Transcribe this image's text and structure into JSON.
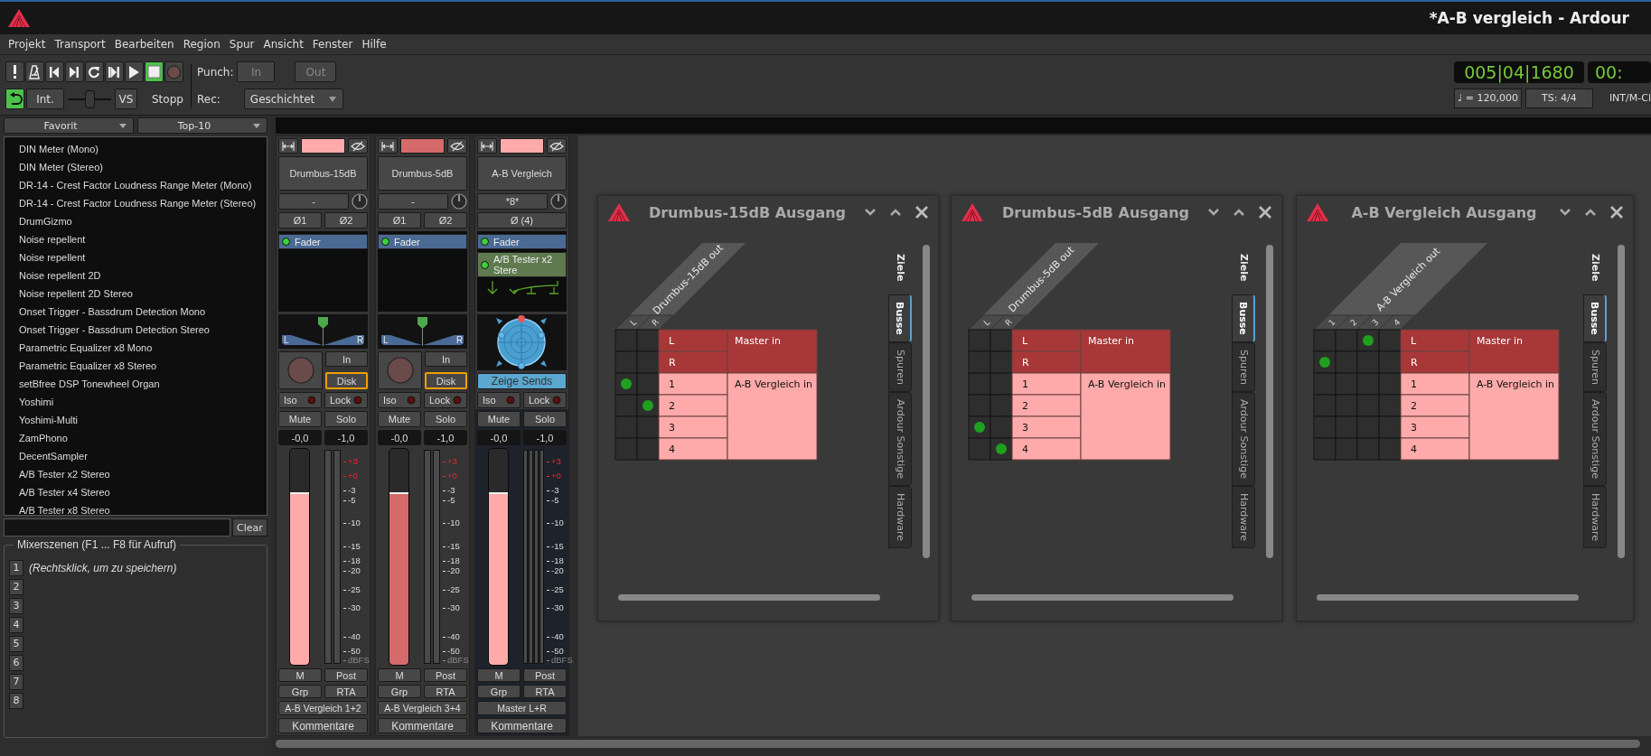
{
  "window": {
    "title": "*A-B vergleich - Ardour"
  },
  "menu": [
    "Projekt",
    "Transport",
    "Bearbeiten",
    "Region",
    "Spur",
    "Ansicht",
    "Fenster",
    "Hilfe"
  ],
  "toolbar": {
    "transport": [
      {
        "kind": "panic",
        "active": false
      },
      {
        "kind": "metronome",
        "active": false
      },
      {
        "kind": "start",
        "active": false
      },
      {
        "kind": "end",
        "active": false
      },
      {
        "kind": "loop",
        "active": false
      },
      {
        "kind": "range",
        "active": false
      },
      {
        "kind": "play",
        "active": false
      },
      {
        "kind": "stop",
        "active": true
      },
      {
        "kind": "record",
        "active": false
      }
    ],
    "auto_return": {
      "active": true
    },
    "sync_button": "Int.",
    "shuttle": {
      "level": 0.5
    },
    "vari_speed": "VS",
    "status": "Stopp",
    "punch_label": "Punch:",
    "punch": [
      {
        "label": "In",
        "disabled": true
      },
      {
        "label": "Out",
        "disabled": true
      }
    ],
    "rec_label": "Rec:",
    "rec_mode": "Geschichtet",
    "clock": "005|04|1680",
    "clock_2": "00:",
    "tempo": "♩ = 120,000",
    "meter": "TS: 4/4",
    "sync_source": "INT/M-Cl"
  },
  "sidebar": {
    "filters": [
      "Favorit",
      "Top-10"
    ],
    "plugins": [
      "DIN Meter (Mono)",
      "DIN Meter (Stereo)",
      "DR-14 - Crest Factor Loudness Range Meter (Mono)",
      "DR-14 - Crest Factor Loudness Range Meter (Stereo)",
      "DrumGizmo",
      "Noise repellent",
      "Noise repellent",
      "Noise repellent 2D",
      "Noise repellent 2D Stereo",
      "Onset Trigger - Bassdrum Detection Mono",
      "Onset Trigger - Bassdrum Detection Stereo",
      "Parametric Equalizer x8 Mono",
      "Parametric Equalizer x8 Stereo",
      "setBfree DSP Tonewheel Organ",
      "Yoshimi",
      "Yoshimi-Multi",
      "ZamPhono",
      "DecentSampler",
      "A/B Tester x2 Stereo",
      "A/B Tester x4 Stereo",
      "A/B Tester x8 Stereo"
    ],
    "clear_button": "Clear",
    "scenes": {
      "title": "Mixerszenen (F1 ... F8 für Aufruf)",
      "slots": [
        {
          "key": "1",
          "label": "(Rechtsklick, um zu speichern)"
        },
        {
          "key": "2"
        },
        {
          "key": "3"
        },
        {
          "key": "4"
        },
        {
          "key": "5"
        },
        {
          "key": "6"
        },
        {
          "key": "7"
        },
        {
          "key": "8"
        }
      ]
    }
  },
  "strips": [
    {
      "kind": "track",
      "color": "#ffaaaa",
      "name": "Drumbus-15dB",
      "input": "-",
      "phase": [
        "Ø1",
        "Ø2"
      ],
      "processors": [
        {
          "kind": "fader",
          "name": "Fader",
          "active": true
        }
      ],
      "panner": {
        "kind": "stereo",
        "left": "L",
        "right": "R"
      },
      "rec_armed": false,
      "monitor": [
        {
          "label": "In",
          "active": false
        },
        {
          "label": "Disk",
          "active": true
        }
      ],
      "iso": "Iso",
      "lock": "Lock",
      "mute": "Mute",
      "solo": "Solo",
      "gain": "-0,0",
      "peak": "-1,0",
      "fader": {
        "level": 0.79
      },
      "meter_scale": [
        {
          "label": "+3",
          "color": "#ff2020"
        },
        {
          "label": "+0",
          "color": "#ff2020"
        },
        {
          "label": "-3",
          "color": "#dddddd"
        },
        {
          "label": "-5",
          "color": "#dddddd"
        },
        {
          "label": "-10",
          "color": "#dddddd"
        },
        {
          "label": "-15",
          "color": "#dddddd"
        },
        {
          "label": "-18",
          "color": "#dddddd"
        },
        {
          "label": "-20",
          "color": "#dddddd"
        },
        {
          "label": "-25",
          "color": "#dddddd"
        },
        {
          "label": "-30",
          "color": "#dddddd"
        },
        {
          "label": "-40",
          "color": "#dddddd"
        },
        {
          "label": "-50",
          "color": "#dddddd"
        },
        {
          "label": "dBFS",
          "color": "#888888"
        }
      ],
      "meter_button": "M",
      "meter_point": "Post",
      "group": "Grp",
      "rta": "RTA",
      "output": "A-B Vergleich 1+2",
      "comments": "Kommentare"
    },
    {
      "kind": "track",
      "color": "#d46a6a",
      "name": "Drumbus-5dB",
      "input": "-",
      "phase": [
        "Ø1",
        "Ø2"
      ],
      "processors": [
        {
          "kind": "fader",
          "name": "Fader",
          "active": true
        }
      ],
      "panner": {
        "kind": "stereo",
        "left": "L",
        "right": "R"
      },
      "rec_armed": false,
      "monitor": [
        {
          "label": "In",
          "active": false
        },
        {
          "label": "Disk",
          "active": true
        }
      ],
      "iso": "Iso",
      "lock": "Lock",
      "mute": "Mute",
      "solo": "Solo",
      "gain": "-0,0",
      "peak": "-1,0",
      "fader": {
        "level": 0.79
      },
      "meter_scale": [
        {
          "label": "+3",
          "color": "#ff2020"
        },
        {
          "label": "+0",
          "color": "#ff2020"
        },
        {
          "label": "-3",
          "color": "#dddddd"
        },
        {
          "label": "-5",
          "color": "#dddddd"
        },
        {
          "label": "-10",
          "color": "#dddddd"
        },
        {
          "label": "-15",
          "color": "#dddddd"
        },
        {
          "label": "-18",
          "color": "#dddddd"
        },
        {
          "label": "-20",
          "color": "#dddddd"
        },
        {
          "label": "-25",
          "color": "#dddddd"
        },
        {
          "label": "-30",
          "color": "#dddddd"
        },
        {
          "label": "-40",
          "color": "#dddddd"
        },
        {
          "label": "-50",
          "color": "#dddddd"
        },
        {
          "label": "dBFS",
          "color": "#888888"
        }
      ],
      "meter_button": "M",
      "meter_point": "Post",
      "group": "Grp",
      "rta": "RTA",
      "output": "A-B Vergleich 3+4",
      "comments": "Kommentare"
    },
    {
      "kind": "bus",
      "color": "#ffaaaa",
      "name": "A-B Vergleich",
      "input": "*8*",
      "phase": [
        "Ø (4)"
      ],
      "processors": [
        {
          "kind": "fader",
          "name": "Fader",
          "active": true
        },
        {
          "kind": "plugin",
          "name": "A/B Tester x2 Stere",
          "active": true
        }
      ],
      "panner": {
        "kind": "surround"
      },
      "sends_button": "Zeige Sends",
      "iso": "Iso",
      "lock": "Lock",
      "mute": "Mute",
      "solo": "Solo",
      "gain": "-0,0",
      "peak": "-1,0",
      "fader": {
        "level": 0.79
      },
      "meter_scale": [
        {
          "label": "+3",
          "color": "#ff2020"
        },
        {
          "label": "+0",
          "color": "#ff2020"
        },
        {
          "label": "-3",
          "color": "#dddddd"
        },
        {
          "label": "-5",
          "color": "#dddddd"
        },
        {
          "label": "-10",
          "color": "#dddddd"
        },
        {
          "label": "-15",
          "color": "#dddddd"
        },
        {
          "label": "-18",
          "color": "#dddddd"
        },
        {
          "label": "-20",
          "color": "#dddddd"
        },
        {
          "label": "-25",
          "color": "#dddddd"
        },
        {
          "label": "-30",
          "color": "#dddddd"
        },
        {
          "label": "-40",
          "color": "#dddddd"
        },
        {
          "label": "-50",
          "color": "#dddddd"
        },
        {
          "label": "dBFS",
          "color": "#888888"
        }
      ],
      "meter_button": "M",
      "meter_point": "Post",
      "group": "Grp",
      "rta": "RTA",
      "output": "Master L+R",
      "comments": "Kommentare"
    }
  ],
  "routing_windows": [
    {
      "title": "Drumbus-15dB Ausgang",
      "columns": {
        "name": "Drumbus-15dB out",
        "ports": [
          "L",
          "R"
        ]
      },
      "rows": [
        {
          "group": "Master in",
          "color": "#a83838",
          "ports": [
            {
              "label": "L",
              "connections": [
                false,
                false
              ]
            },
            {
              "label": "R",
              "connections": [
                false,
                false
              ]
            }
          ]
        },
        {
          "group": "A-B Vergleich in",
          "color": "#ffaaaa",
          "ports": [
            {
              "label": "1",
              "connections": [
                true,
                false
              ]
            },
            {
              "label": "2",
              "connections": [
                false,
                true
              ]
            },
            {
              "label": "3",
              "connections": [
                false,
                false
              ]
            },
            {
              "label": "4",
              "connections": [
                false,
                false
              ]
            }
          ]
        }
      ],
      "tabs_heading": "Ziele",
      "tabs": [
        {
          "label": "Busse",
          "selected": true
        },
        {
          "label": "Spuren",
          "selected": false
        },
        {
          "label": "Ardour Sonstige",
          "selected": false
        },
        {
          "label": "Hardware",
          "selected": false
        }
      ]
    },
    {
      "title": "Drumbus-5dB Ausgang",
      "columns": {
        "name": "Drumbus-5dB out",
        "ports": [
          "L",
          "R"
        ]
      },
      "rows": [
        {
          "group": "Master in",
          "color": "#a83838",
          "ports": [
            {
              "label": "L",
              "connections": [
                false,
                false
              ]
            },
            {
              "label": "R",
              "connections": [
                false,
                false
              ]
            }
          ]
        },
        {
          "group": "A-B Vergleich in",
          "color": "#ffaaaa",
          "ports": [
            {
              "label": "1",
              "connections": [
                false,
                false
              ]
            },
            {
              "label": "2",
              "connections": [
                false,
                false
              ]
            },
            {
              "label": "3",
              "connections": [
                true,
                false
              ]
            },
            {
              "label": "4",
              "connections": [
                false,
                true
              ]
            }
          ]
        }
      ],
      "tabs_heading": "Ziele",
      "tabs": [
        {
          "label": "Busse",
          "selected": true
        },
        {
          "label": "Spuren",
          "selected": false
        },
        {
          "label": "Ardour Sonstige",
          "selected": false
        },
        {
          "label": "Hardware",
          "selected": false
        }
      ]
    },
    {
      "title": "A-B Vergleich Ausgang",
      "columns": {
        "name": "A-B Vergleich out",
        "ports": [
          "1",
          "2",
          "3",
          "4"
        ]
      },
      "rows": [
        {
          "group": "Master in",
          "color": "#a83838",
          "ports": [
            {
              "label": "L",
              "connections": [
                false,
                false,
                true,
                false
              ]
            },
            {
              "label": "R",
              "connections": [
                true,
                false,
                false,
                false
              ]
            }
          ]
        },
        {
          "group": "A-B Vergleich in",
          "color": "#ffaaaa",
          "ports": [
            {
              "label": "1",
              "connections": [
                false,
                false,
                false,
                false
              ]
            },
            {
              "label": "2",
              "connections": [
                false,
                false,
                false,
                false
              ]
            },
            {
              "label": "3",
              "connections": [
                false,
                false,
                false,
                false
              ]
            },
            {
              "label": "4",
              "connections": [
                false,
                false,
                false,
                false
              ]
            }
          ]
        }
      ],
      "tabs_heading": "Ziele",
      "tabs": [
        {
          "label": "Busse",
          "selected": true
        },
        {
          "label": "Spuren",
          "selected": false
        },
        {
          "label": "Ardour Sonstige",
          "selected": false
        },
        {
          "label": "Hardware",
          "selected": false
        }
      ]
    }
  ]
}
